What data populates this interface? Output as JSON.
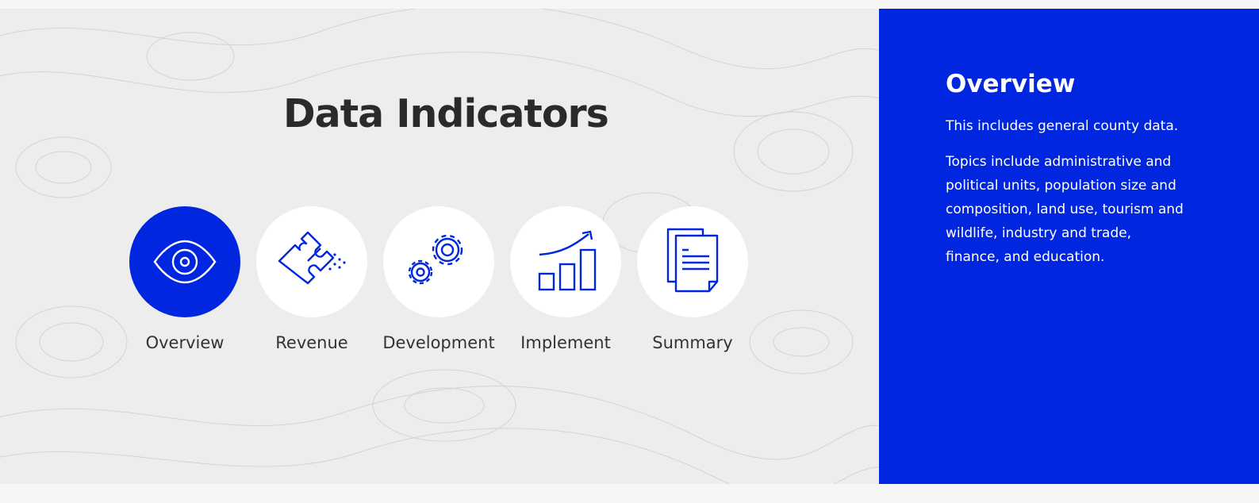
{
  "page": {
    "title_part1": "Data",
    "title_part2": "Indicators"
  },
  "nav": {
    "items": [
      {
        "label": "Overview",
        "icon": "eye-icon",
        "active": true
      },
      {
        "label": "Revenue",
        "icon": "puzzle-icon",
        "active": false
      },
      {
        "label": "Development",
        "icon": "gears-icon",
        "active": false
      },
      {
        "label": "Implement",
        "icon": "growth-chart-icon",
        "active": false
      },
      {
        "label": "Summary",
        "icon": "documents-icon",
        "active": false
      }
    ]
  },
  "panel": {
    "title": "Overview",
    "paragraph1": "This includes general county data.",
    "paragraph2": "Topics include administrative and political units, population size and composition, land use, tourism and wildlife, industry and trade, finance, and education."
  },
  "colors": {
    "accent": "#0026e0",
    "background": "#ededed",
    "title_text": "#2a2a2a",
    "highlight": "#d6d9ef"
  }
}
